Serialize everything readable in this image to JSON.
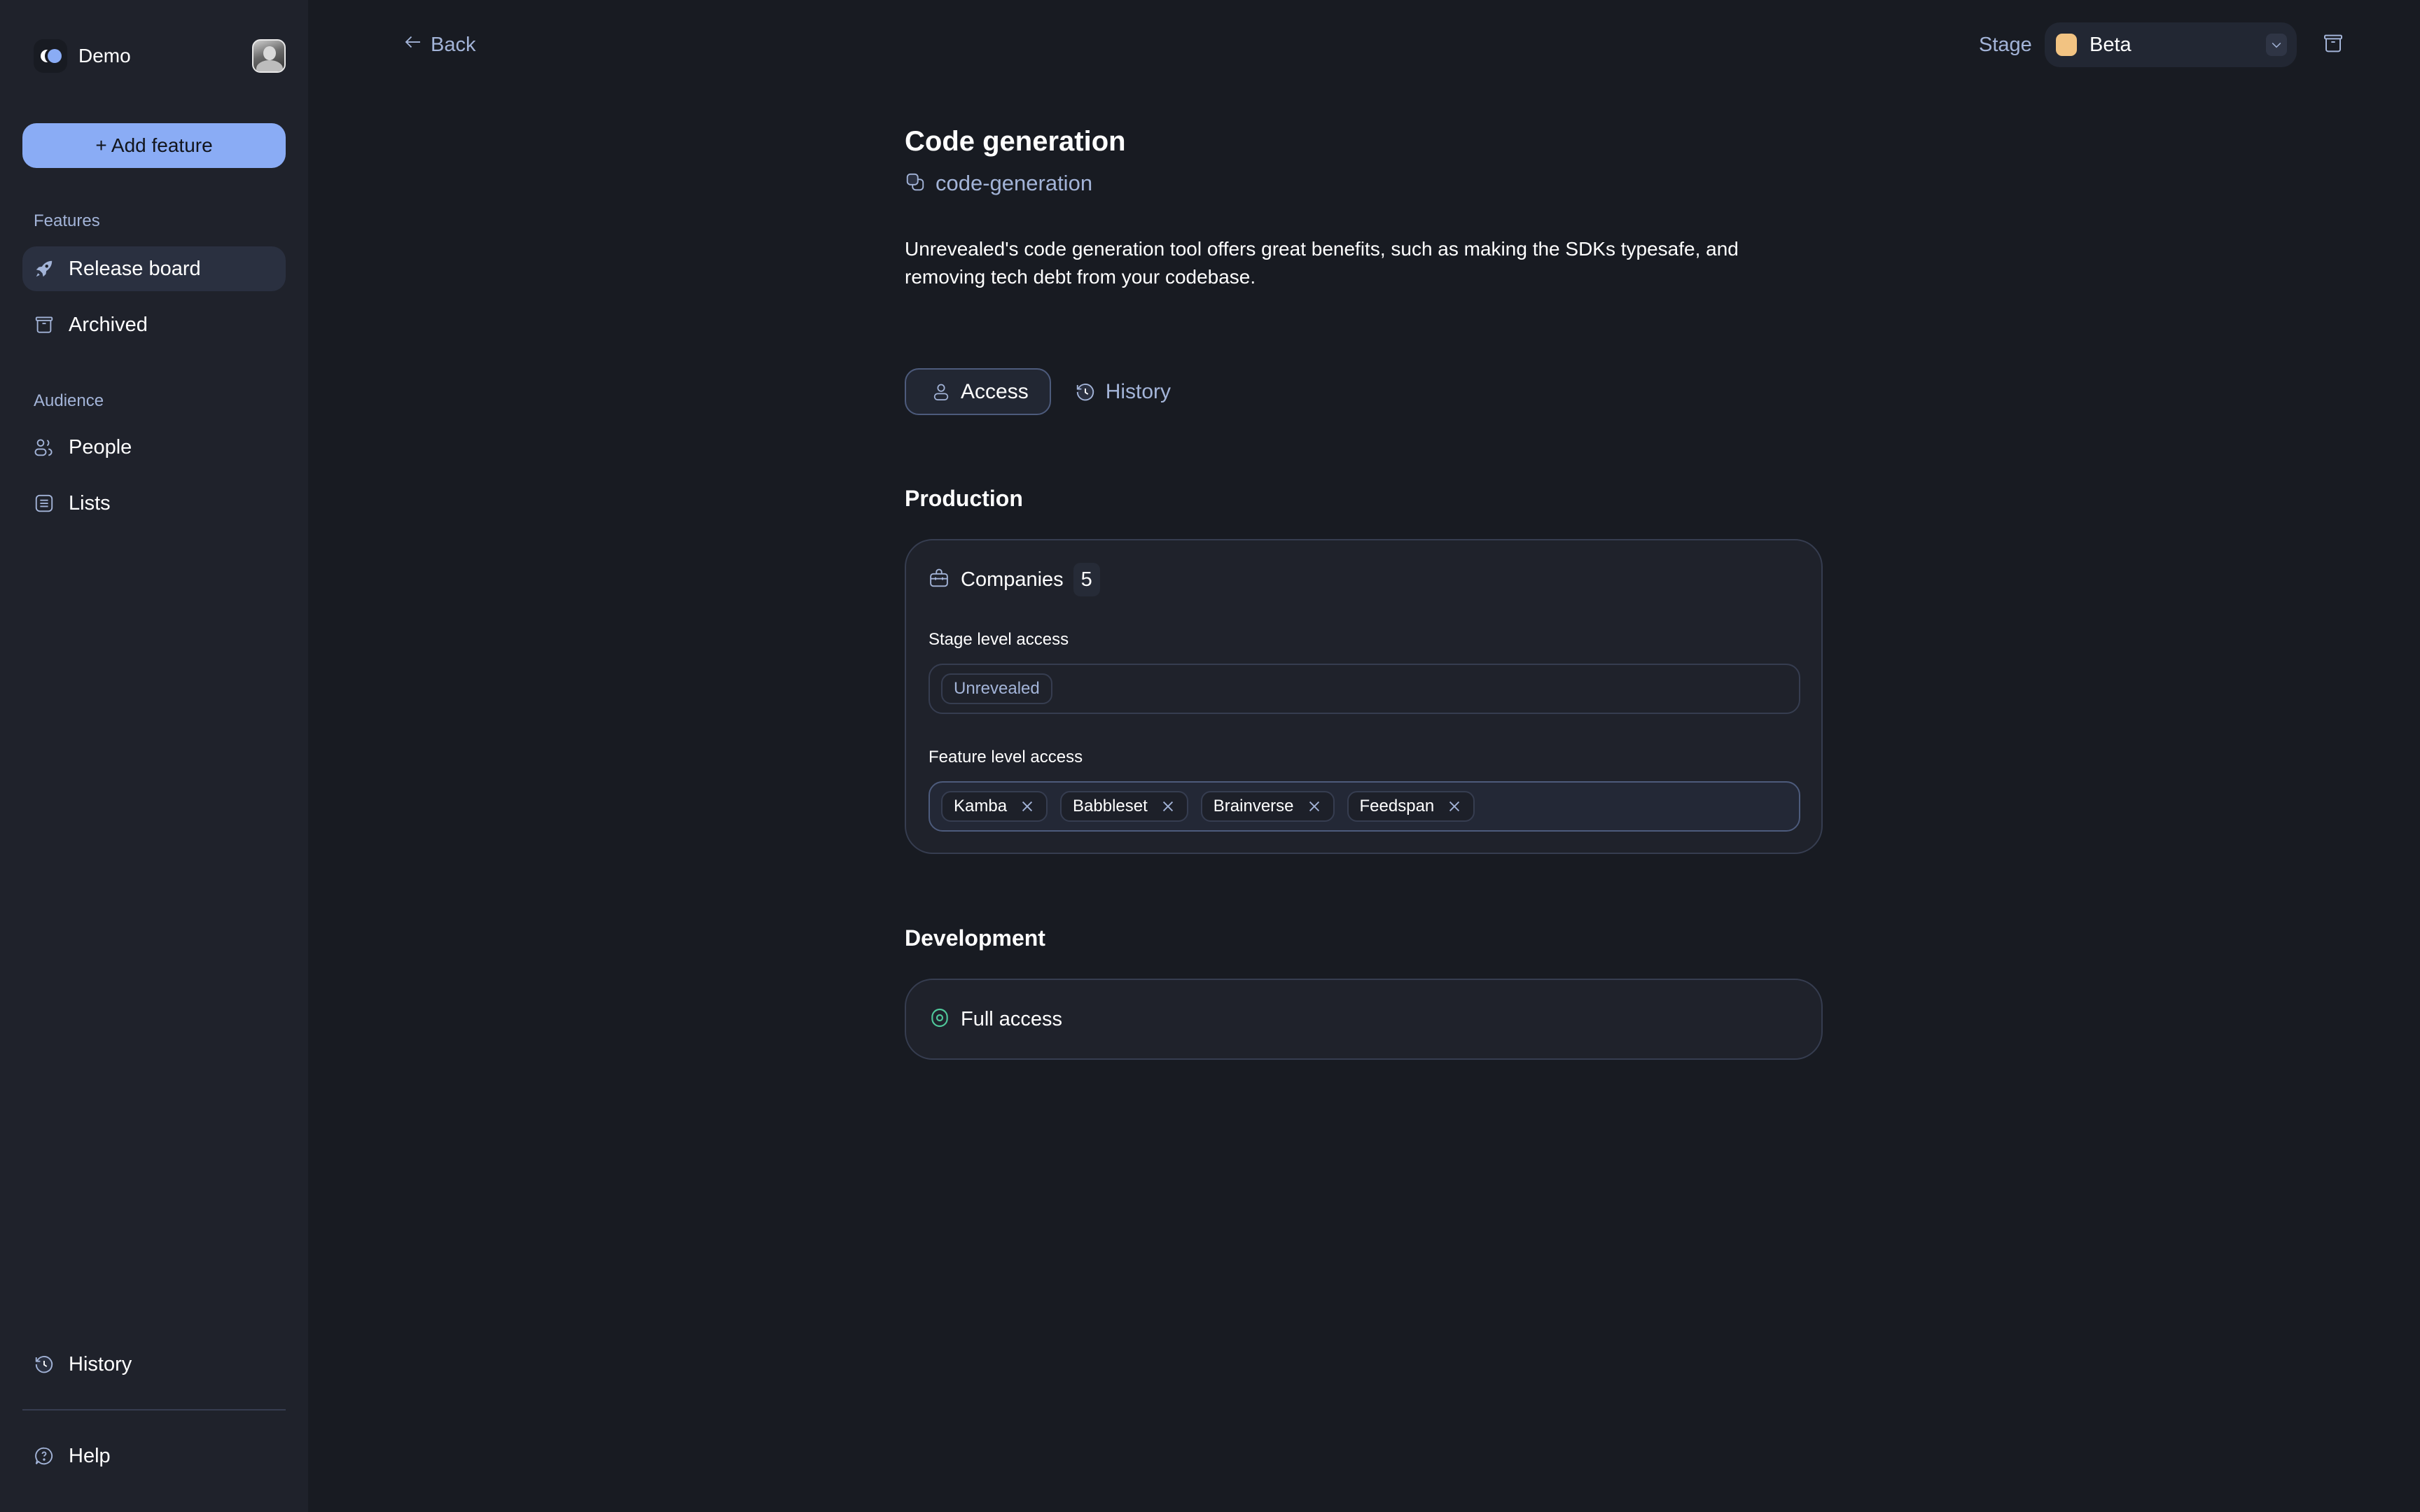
{
  "sidebar": {
    "workspace_name": "Demo",
    "add_feature_label": "+ Add feature",
    "sections": [
      {
        "label": "Features",
        "items": [
          {
            "label": "Release board",
            "icon": "rocket-icon",
            "active": true
          },
          {
            "label": "Archived",
            "icon": "archive-icon",
            "active": false
          }
        ]
      },
      {
        "label": "Audience",
        "items": [
          {
            "label": "People",
            "icon": "people-icon",
            "active": false
          },
          {
            "label": "Lists",
            "icon": "list-icon",
            "active": false
          }
        ]
      }
    ],
    "footer": [
      {
        "label": "History",
        "icon": "history-icon"
      },
      {
        "label": "Help",
        "icon": "help-icon"
      }
    ]
  },
  "topbar": {
    "back_label": "Back",
    "stage_label": "Stage",
    "stage_value": "Beta",
    "stage_color": "#f2c382"
  },
  "feature": {
    "title": "Code generation",
    "slug": "code-generation",
    "description": "Unrevealed's code generation tool offers great benefits, such as making the SDKs typesafe, and removing tech debt from your codebase."
  },
  "tabs": [
    {
      "label": "Access",
      "icon": "user-icon",
      "active": true
    },
    {
      "label": "History",
      "icon": "history-icon",
      "active": false
    }
  ],
  "production": {
    "heading": "Production",
    "entity_label": "Companies",
    "entity_count": "5",
    "stage_access_label": "Stage level access",
    "stage_access_tags": [
      "Unrevealed"
    ],
    "feature_access_label": "Feature level access",
    "feature_access_tags": [
      "Kamba",
      "Babbleset",
      "Brainverse",
      "Feedspan"
    ]
  },
  "development": {
    "heading": "Development",
    "access_label": "Full access",
    "access_color": "#4fc79a"
  },
  "colors": {
    "accent": "#8aacf5",
    "muted_text": "#a3b4d8",
    "background": "#181b22",
    "sidebar": "#1f222b"
  }
}
